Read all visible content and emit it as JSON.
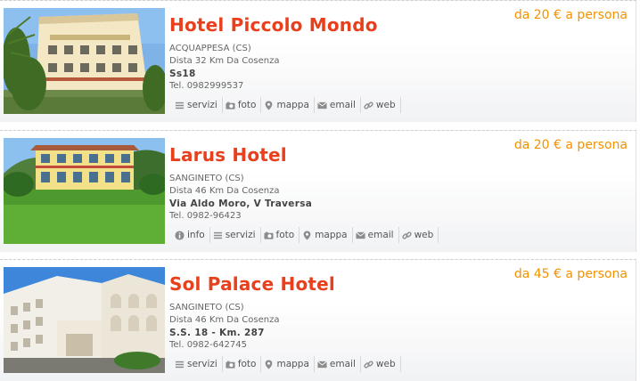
{
  "listings": [
    {
      "name": "Hotel Piccolo Mondo",
      "price": "da 20 € a persona",
      "location": "ACQUAPPESA (CS)",
      "distance": "Dista 32 Km Da Cosenza",
      "address": "Ss18",
      "phone": "Tel. 0982999537",
      "actions": [
        "servizi",
        "foto",
        "mappa",
        "email",
        "web"
      ]
    },
    {
      "name": "Larus Hotel",
      "price": "da 20 € a persona",
      "location": "SANGINETO (CS)",
      "distance": "Dista 46 Km Da Cosenza",
      "address": "Via Aldo Moro, V Traversa",
      "phone": "Tel. 0982-96423",
      "actions": [
        "info",
        "servizi",
        "foto",
        "mappa",
        "email",
        "web"
      ]
    },
    {
      "name": "Sol Palace Hotel",
      "price": "da 45 € a persona",
      "location": "SANGINETO (CS)",
      "distance": "Dista 46 Km Da Cosenza",
      "address": "S.S. 18 - Km. 287",
      "phone": "Tel. 0982-642745",
      "actions": [
        "servizi",
        "foto",
        "mappa",
        "email",
        "web"
      ]
    }
  ],
  "icons": {
    "info": "info-icon",
    "servizi": "list-icon",
    "foto": "camera-icon",
    "mappa": "map-pin-icon",
    "email": "envelope-icon",
    "web": "link-icon"
  },
  "colors": {
    "name": "#e8401c",
    "price": "#f39200"
  }
}
